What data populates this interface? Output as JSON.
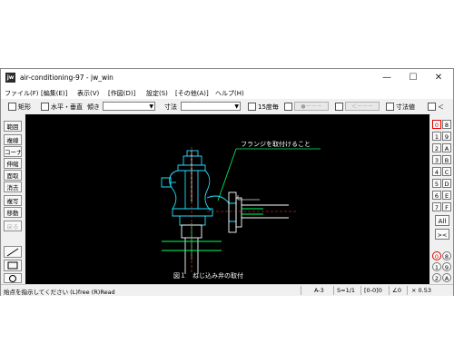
{
  "window": {
    "title": "air-conditioning-97 - jw_win",
    "icon_text": "jw"
  },
  "window_controls": {
    "minimize": "—",
    "maximize": "☐",
    "close": "✕"
  },
  "menu": [
    "ファイル(F)",
    "[編集(E)]",
    "表示(V)",
    "[作図(D)]",
    "設定(S)",
    "[その他(A)]",
    "ヘルプ(H)"
  ],
  "toolbar": {
    "rect_label": "矩形",
    "hv_label": "水平・垂直",
    "slope_label": "傾き",
    "dim_label": "寸法",
    "deg15_label": "15度毎",
    "point_btn": "●－－－",
    "arrow_btn": "＜－－－",
    "dimvalue_label": "寸法値",
    "last_label": "＜",
    "slope_value": "",
    "dim_value": ""
  },
  "left_tools": [
    "範囲",
    "複線",
    "コーナー",
    "伸縮",
    "面取",
    "消去",
    "複写",
    "移動",
    "戻る"
  ],
  "right_layers": {
    "row1": [
      "0",
      "8"
    ],
    "row2": [
      "1",
      "9"
    ],
    "row3": [
      "2",
      "A"
    ],
    "row4": [
      "3",
      "B"
    ],
    "row5": [
      "4",
      "C"
    ],
    "row6": [
      "5",
      "D"
    ],
    "row7": [
      "6",
      "E"
    ],
    "row8": [
      "7",
      "F"
    ],
    "all": "All",
    "swap": "><",
    "bottom": [
      "0",
      "8",
      "1",
      "9",
      "2",
      "A"
    ]
  },
  "drawing": {
    "annotation": "フランジを取付けること",
    "caption": "図１　ねじ込み弁の取付"
  },
  "status": {
    "prompt": "始点を指示してください (L)free (R)Read",
    "paper": "A-3",
    "scale": "S=1/1",
    "layer": "[0-0]0",
    "angle": "∠0",
    "zoom": "× 0.53"
  }
}
